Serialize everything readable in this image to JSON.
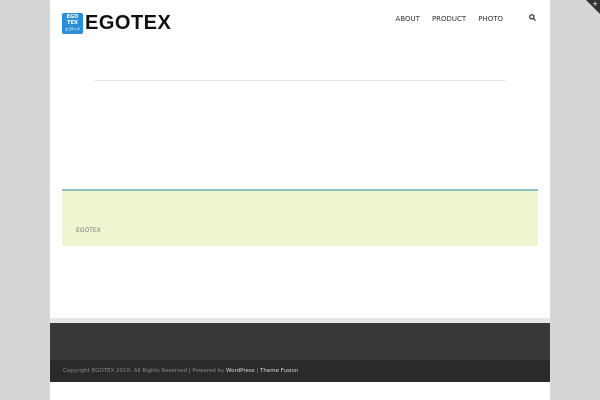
{
  "logo": {
    "badge_lines": [
      "EGO",
      "TEX",
      "エゴテック"
    ],
    "text": "EGOTEX"
  },
  "nav": {
    "items": [
      "ABOUT",
      "PRODUCT",
      "PHOTO"
    ],
    "search_icon": "search-icon"
  },
  "content": {
    "box_text": "EGOTEX"
  },
  "footer": {
    "copyright": "Copyright EGOTEX 2010- All Rights Reserved | Powered by ",
    "wordpress": "WordPress",
    "sep": " | ",
    "theme": "Theme Fusion"
  },
  "colors": {
    "accent": "#8fc1bd",
    "box_bg": "#eef5d0",
    "footer": "#363839"
  }
}
